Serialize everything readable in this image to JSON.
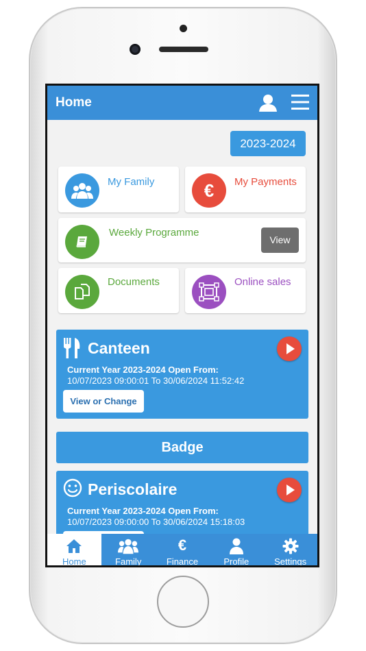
{
  "appbar": {
    "title": "Home"
  },
  "year_selector": {
    "label": "2023-2024"
  },
  "cards": {
    "family": {
      "label": "My Family",
      "color": "#3a99df"
    },
    "payments": {
      "label": "My Payments",
      "color": "#e74c3c"
    },
    "weekly": {
      "label": "Weekly Programme",
      "color": "#5aa83c",
      "view_label": "View"
    },
    "documents": {
      "label": "Documents",
      "color": "#5aa83c"
    },
    "online_sales": {
      "label": "Online sales",
      "color": "#9b4fc0"
    }
  },
  "canteen": {
    "title": "Canteen",
    "line1": "Current Year 2023-2024 Open From:",
    "line2": "10/07/2023 09:00:01 To 30/06/2024 11:52:42",
    "button": "View or Change"
  },
  "badge": {
    "label": "Badge"
  },
  "periscolaire": {
    "title": "Periscolaire",
    "line1": "Current Year 2023-2024 Open From:",
    "line2": "10/07/2023 09:00:00 To 30/06/2024 15:18:03"
  },
  "tabs": [
    {
      "label": "Home",
      "icon": "home-icon"
    },
    {
      "label": "Family",
      "icon": "group-icon"
    },
    {
      "label": "Finance",
      "icon": "euro-icon"
    },
    {
      "label": "Profile",
      "icon": "person-icon"
    },
    {
      "label": "Settings",
      "icon": "gear-icon"
    }
  ],
  "colors": {
    "primary": "#3a8fd8",
    "accent_red": "#e74c3c"
  }
}
